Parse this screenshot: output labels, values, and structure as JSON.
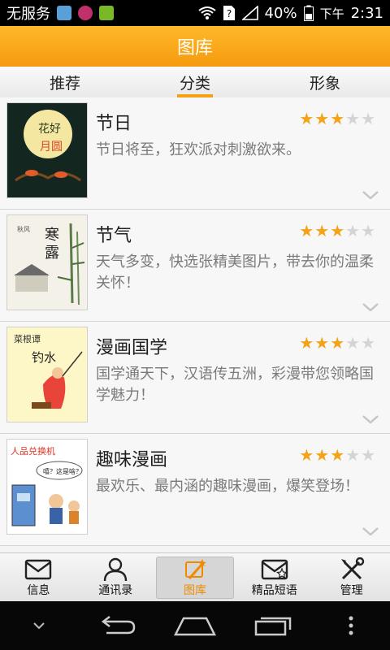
{
  "status": {
    "carrier": "无服务",
    "battery": "40%",
    "period": "下午",
    "time": "2:31"
  },
  "title": "图库",
  "tabs": [
    {
      "label": "推荐",
      "active": false
    },
    {
      "label": "分类",
      "active": true
    },
    {
      "label": "形象",
      "active": false
    }
  ],
  "items": [
    {
      "title": "节日",
      "desc": "节日将至，狂欢派对刺激欲来。",
      "rating": 3,
      "max": 5,
      "thumb_icon": "moon-festival-thumbnail",
      "thumb_text": "花好月圆"
    },
    {
      "title": "节气",
      "desc": "天气多变，快选张精美图片，带去你的温柔关怀！",
      "rating": 3,
      "max": 5,
      "thumb_icon": "bamboo-painting-thumbnail",
      "thumb_text": "寒露"
    },
    {
      "title": "漫画国学",
      "desc": "国学通天下，汉语传五洲，彩漫带您领略国学魅力！",
      "rating": 3,
      "max": 5,
      "thumb_icon": "comic-fishing-thumbnail",
      "thumb_text": "菜根谭",
      "thumb_text2": "钓水"
    },
    {
      "title": "趣味漫画",
      "desc": "最欢乐、最内涵的趣味漫画，爆笑登场！",
      "rating": 3,
      "max": 5,
      "thumb_icon": "comic-machine-thumbnail",
      "thumb_text": "人品兑换机",
      "thumb_text2": "嘻？这是啥？",
      "thumb_text3": "人品兑换机。"
    }
  ],
  "nav": [
    {
      "label": "信息",
      "icon": "envelope-icon",
      "active": false
    },
    {
      "label": "通讯录",
      "icon": "person-icon",
      "active": false
    },
    {
      "label": "图库",
      "icon": "magic-wand-icon",
      "active": true
    },
    {
      "label": "精品短语",
      "icon": "star-envelope-icon",
      "active": false
    },
    {
      "label": "管理",
      "icon": "tools-icon",
      "active": false
    }
  ],
  "colors": {
    "accent": "#f59a0e",
    "star_on": "#f4a218",
    "star_off": "#d4d4d4"
  }
}
